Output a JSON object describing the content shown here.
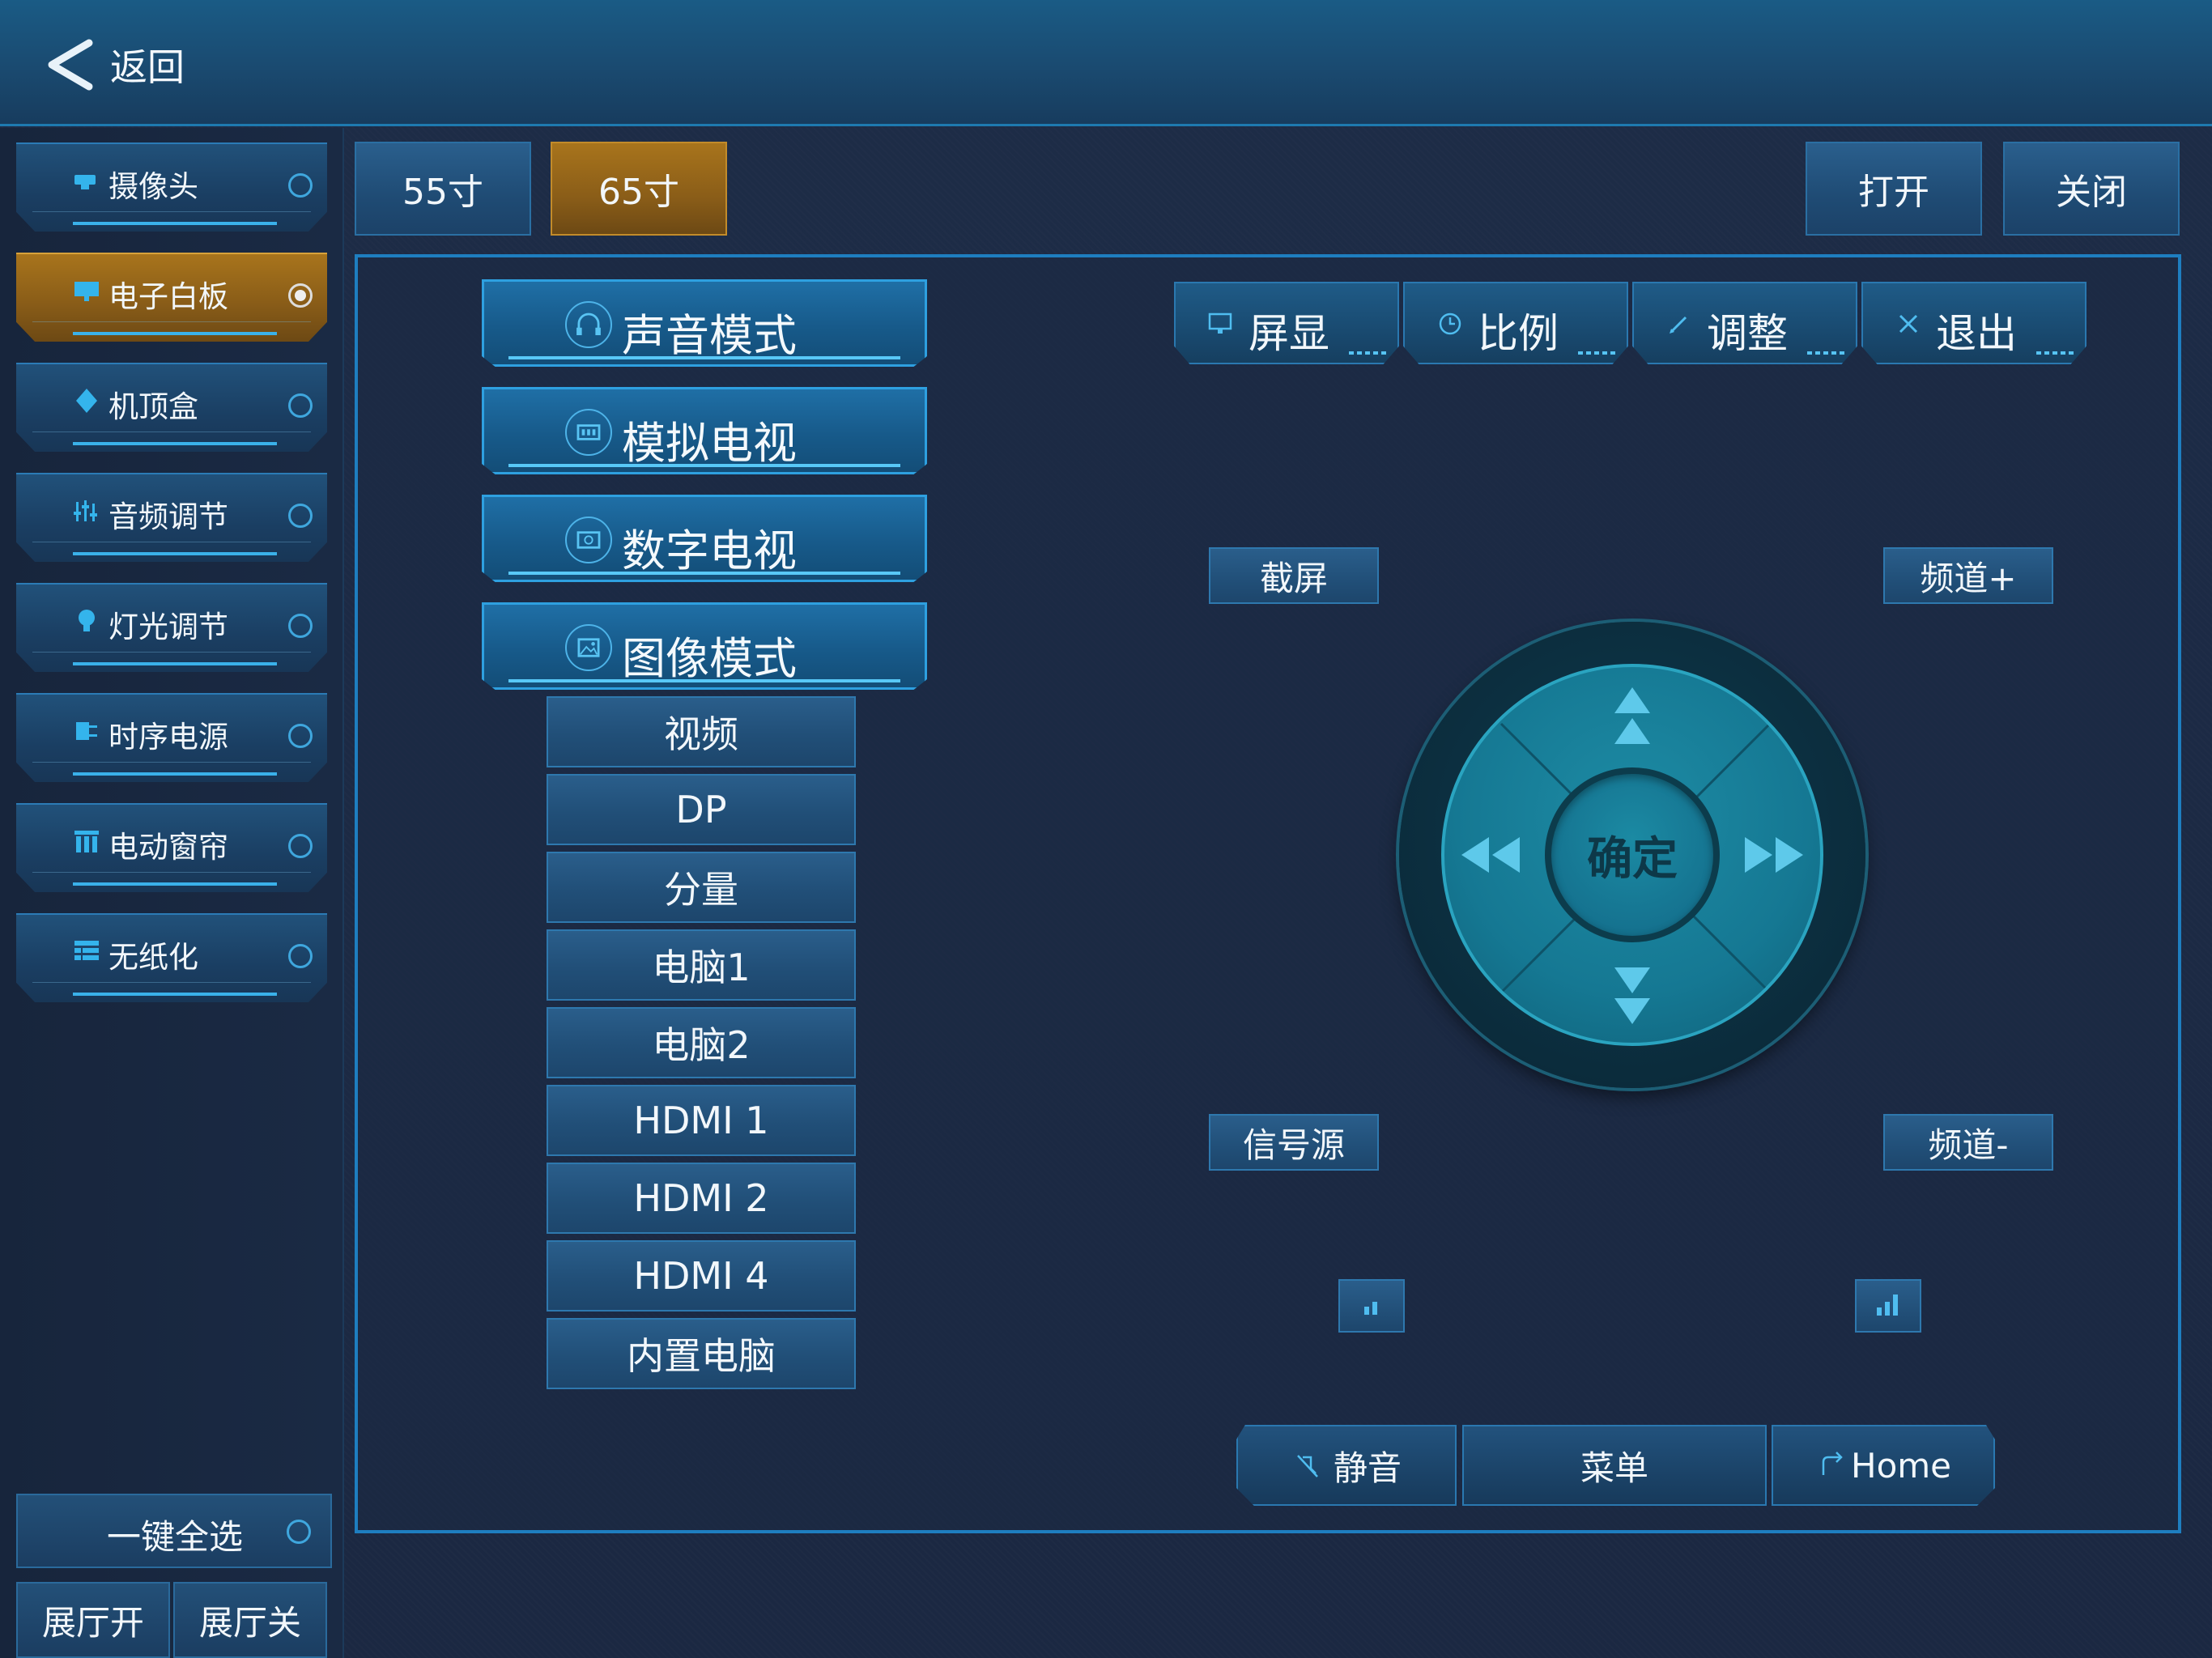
{
  "header": {
    "back_label": "返回"
  },
  "sidebar": {
    "items": [
      {
        "label": "摄像头",
        "icon": "camera-icon",
        "active": false
      },
      {
        "label": "电子白板",
        "icon": "monitor-icon",
        "active": true
      },
      {
        "label": "机顶盒",
        "icon": "set-top-box-icon",
        "active": false
      },
      {
        "label": "音频调节",
        "icon": "equalizer-icon",
        "active": false
      },
      {
        "label": "灯光调节",
        "icon": "bulb-icon",
        "active": false
      },
      {
        "label": "时序电源",
        "icon": "power-plug-icon",
        "active": false
      },
      {
        "label": "电动窗帘",
        "icon": "curtain-icon",
        "active": false
      },
      {
        "label": "无纸化",
        "icon": "paperless-icon",
        "active": false
      }
    ],
    "select_all": "一键全选",
    "hall_on": "展厅开",
    "hall_off": "展厅关"
  },
  "sizes": {
    "s55": "55寸",
    "s65": "65寸",
    "selected": "65寸"
  },
  "power": {
    "open": "打开",
    "close": "关闭"
  },
  "modes": [
    {
      "label": "声音模式",
      "icon": "headphones-icon"
    },
    {
      "label": "模拟电视",
      "icon": "analog-tv-icon"
    },
    {
      "label": "数字电视",
      "icon": "digital-tv-icon"
    },
    {
      "label": "图像模式",
      "icon": "image-icon"
    }
  ],
  "sources": [
    "视频",
    "DP",
    "分量",
    "电脑1",
    "电脑2",
    "HDMI 1",
    "HDMI 2",
    "HDMI 4",
    "内置电脑"
  ],
  "functions": [
    {
      "label": "屏显",
      "icon": "display-icon"
    },
    {
      "label": "比例",
      "icon": "clock-icon"
    },
    {
      "label": "调整",
      "icon": "pencil-icon"
    },
    {
      "label": "退出",
      "icon": "close-icon"
    }
  ],
  "remote": {
    "screenshot": "截屏",
    "channel_up": "频道+",
    "source": "信号源",
    "channel_down": "频道-",
    "ok": "确定"
  },
  "bottom": {
    "mute": "静音",
    "menu": "菜单",
    "home": "Home"
  },
  "colors": {
    "accent": "#2ea0e0",
    "selected": "#8a5d18",
    "background": "#1a2740"
  }
}
